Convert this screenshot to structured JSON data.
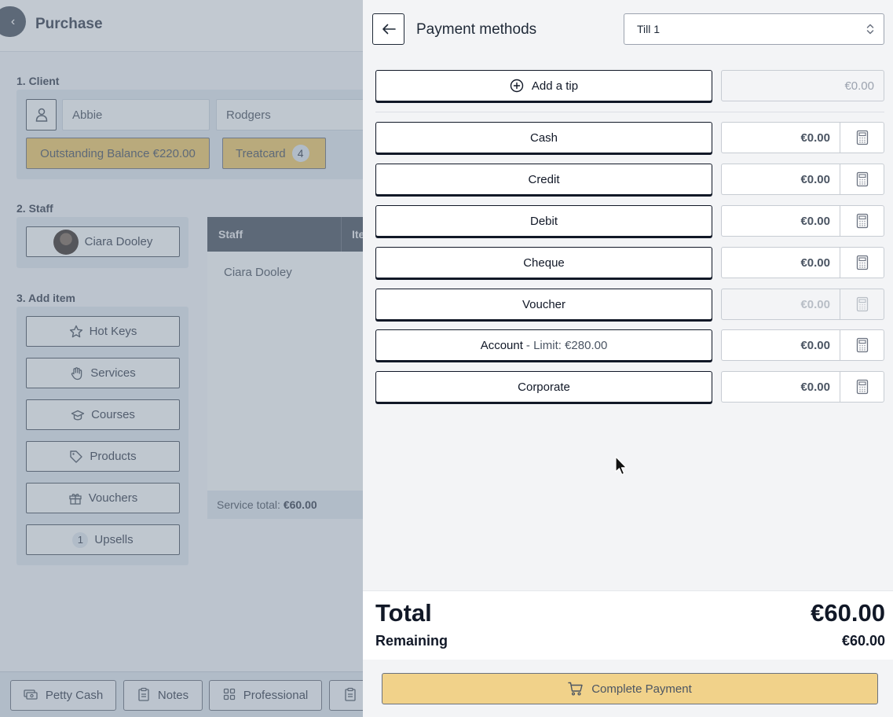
{
  "background_page": {
    "title": "Purchase",
    "client": {
      "section_label": "1. Client",
      "first_name": "Abbie",
      "last_name": "Rodgers",
      "outstanding_balance": "Outstanding Balance €220.00",
      "treatcard_label": "Treatcard",
      "treatcard_count": "4"
    },
    "staff": {
      "section_label": "2. Staff",
      "selected_staff": "Ciara Dooley",
      "table_header_staff": "Staff",
      "table_header_item": "Ite",
      "row_staff": "Ciara Dooley",
      "service_total_label": "Service total:",
      "service_total_value": "€60.00"
    },
    "add_item": {
      "section_label": "3. Add item",
      "hot_keys": "Hot Keys",
      "services": "Services",
      "courses": "Courses",
      "products": "Products",
      "vouchers": "Vouchers",
      "upsells_count": "1",
      "upsells": "Upsells"
    },
    "footer": {
      "petty_cash": "Petty Cash",
      "notes": "Notes",
      "professional": "Professional"
    }
  },
  "panel": {
    "title": "Payment methods",
    "till_selected": "Till 1",
    "add_tip_label": "Add a tip",
    "tip_amount": "€0.00",
    "methods": [
      {
        "label": "Cash",
        "amount": "€0.00"
      },
      {
        "label": "Credit",
        "amount": "€0.00"
      },
      {
        "label": "Debit",
        "amount": "€0.00"
      },
      {
        "label": "Cheque",
        "amount": "€0.00"
      },
      {
        "label": "Voucher",
        "amount": "€0.00"
      },
      {
        "label": "Account",
        "limit": "- Limit: €280.00",
        "amount": "€0.00"
      },
      {
        "label": "Corporate",
        "amount": "€0.00"
      }
    ],
    "total_label": "Total",
    "total_value": "€60.00",
    "remaining_label": "Remaining",
    "remaining_value": "€60.00",
    "complete_payment": "Complete Payment"
  },
  "colors": {
    "accent_yellow": "#f1d28a",
    "balance_yellow": "#e9c46a",
    "header_dark": "#4b5563"
  }
}
